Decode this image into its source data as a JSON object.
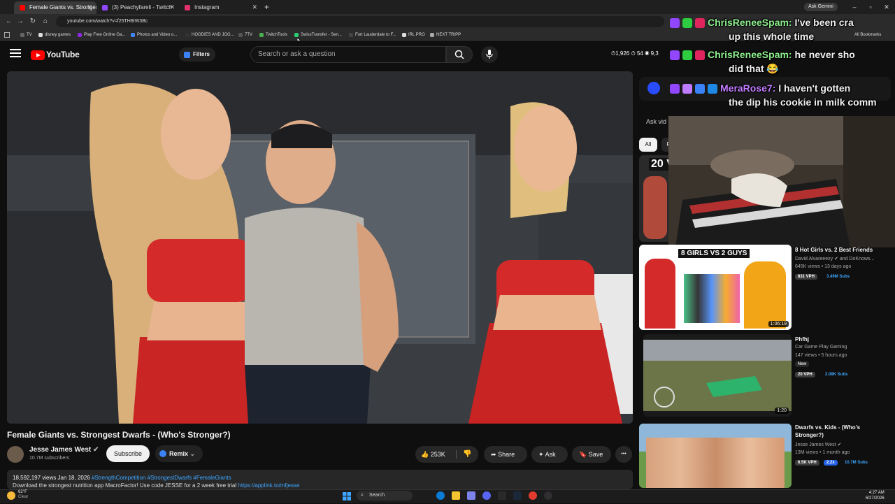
{
  "browser": {
    "tabs": [
      {
        "label": "Female Giants vs. Strongest Dw"
      },
      {
        "label": "(3) Peachyfareli - Twitch"
      },
      {
        "label": "Instagram"
      }
    ],
    "new_tab": "+",
    "ask_gemini": "Ask Gemini",
    "url": "youtube.com/watch?v=f25TH8IW3Bc",
    "window_controls": {
      "minimize": "–",
      "maximize": "▫",
      "close": "✕"
    },
    "bookmarks": [
      {
        "label": "TV"
      },
      {
        "label": "disney games"
      },
      {
        "label": "Play Free Online Ga..."
      },
      {
        "label": "Photos and Video o..."
      },
      {
        "label": "HOODIES AND JOG..."
      },
      {
        "label": "7TV"
      },
      {
        "label": "TwitchTools"
      },
      {
        "label": "SwissTransfer - Sen..."
      },
      {
        "label": "Fort Lauderdale to F..."
      },
      {
        "label": "IRL PRO"
      },
      {
        "label": "NEXT TRIPP"
      }
    ],
    "all_bookmarks": "All Bookmarks"
  },
  "youtube": {
    "logo_text": "YouTube",
    "filters_label": "Filters",
    "search_placeholder": "Search or ask a question",
    "stats": "⏱1,926  ⏱ 54  ◉ 9,3"
  },
  "overlay": {
    "chat": [
      {
        "user": "ChrisReneeSpam:",
        "msg": " I've been cra",
        "cont": "up this whole time"
      },
      {
        "user": "ChrisReneeSpam:",
        "msg": " he never sho",
        "cont": "did that 😂"
      },
      {
        "user": "MeraRose7:",
        "msg": " I haven't gotten",
        "cont": "the dip his cookie in milk comm"
      }
    ]
  },
  "video": {
    "title": "Female Giants vs. Strongest Dwarfs - (Who's Stronger?)",
    "channel": "Jesse James West",
    "subscribers": "10.7M subscribers",
    "subscribe_label": "Subscribe",
    "remix_label": "Remix",
    "likes": "253K",
    "share_label": "Share",
    "ask_label": "Ask",
    "save_label": "Save",
    "more_label": "•••",
    "views_date": "18,592,197 views  Jan 18, 2026",
    "hashtags": "#StrengthCompetition #StrongestDwarfs #FemaleGiants",
    "desc_line": "Download the strongest nutrition app MacroFactor! Use code JESSE for a 2 week free trial",
    "desc_link": "https://applink.to/mfjesse"
  },
  "sidebar": {
    "ask_label": "Ask vid",
    "chips": [
      "All",
      "F"
    ],
    "items": [
      {
        "thumb_text": "20 V",
        "title": "",
        "channel": "",
        "meta": "",
        "duration": ""
      },
      {
        "thumb_text": "8 GIRLS VS 2 GUYS",
        "title": "8 Hot Girls vs. 2 Best Friends",
        "channel": "David Alvareeezy ✔ and DoKnows...",
        "meta": "645K views • 13 days ago",
        "duration": "1:06:19",
        "vph": "831 VPH",
        "subs": "3.49M Subs"
      },
      {
        "thumb_text": "",
        "title": "Phfhj",
        "channel": "Car Game Play Gaming",
        "meta": "147 views • 5 hours ago",
        "badge": "New",
        "duration": "1:20",
        "vph": "20 VPH",
        "subs": "2.08K Subs"
      },
      {
        "thumb_text": "",
        "title": "Dwarfs vs. Kids - (Who's Stronger?)",
        "channel": "Jesse James West ✔",
        "meta": "13M views • 1 month ago",
        "duration": "",
        "vph": "6.5K VPH",
        "multiplier": "2.2x",
        "subs": "10.7M Subs"
      }
    ]
  },
  "taskbar": {
    "weather_temp": "62°F",
    "weather_desc": "Clear",
    "search_label": "Search",
    "time": "4:27 AM",
    "date": "6/27/2026"
  }
}
